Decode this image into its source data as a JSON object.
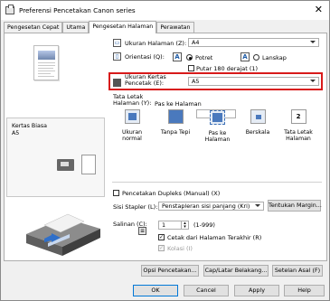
{
  "window": {
    "title": "Preferensi Pencetakan Canon       series"
  },
  "tabs": [
    "Pengesetan Cepat",
    "Utama",
    "Pengesetan Halaman",
    "Perawatan"
  ],
  "preview": {
    "media_line1": "Kertas Biasa",
    "media_line2": "A5"
  },
  "page_size": {
    "label": "Ukuran Halaman (Z):",
    "value": "A4"
  },
  "orientation": {
    "label": "Orientasi (Q):",
    "portrait": "Potret",
    "landscape": "Lanskap",
    "rotate": "Putar 180 derajat (1)",
    "icon_letter": "A"
  },
  "printer_paper": {
    "label_line1": "Ukuran Kertas",
    "label_line2": "Pencetak (E):",
    "value": "A5"
  },
  "layout": {
    "label_line1": "Tata Letak",
    "label_line2": "Halaman (Y):",
    "current": "Pas ke Halaman",
    "items": [
      {
        "name1": "Ukuran normal",
        "name2": ""
      },
      {
        "name1": "Tanpa Tepi",
        "name2": ""
      },
      {
        "name1": "Pas ke",
        "name2": "Halaman"
      },
      {
        "name1": "Berskala",
        "name2": ""
      },
      {
        "name1": "Tata Letak",
        "name2": "Halaman"
      }
    ]
  },
  "duplex": {
    "label": "Pencetakan Dupleks (Manual) (X)"
  },
  "stapling": {
    "label": "Sisi Stapler (L):",
    "value": "Penstapleran sisi panjang (Kri)",
    "button": "Tentukan Margin..."
  },
  "copies": {
    "label": "Salinan (C):",
    "value": "1",
    "range": "(1-999)",
    "reverse": "Cetak dari Halaman Terakhir (R)",
    "collate": "Kolasi (I)"
  },
  "buttons": {
    "print_options": "Opsi Pencetakan...",
    "stamp": "Cap/Latar Belakang...",
    "defaults": "Setelan Asal (F)",
    "ok": "OK",
    "cancel": "Cancel",
    "apply": "Apply",
    "help": "Help"
  }
}
